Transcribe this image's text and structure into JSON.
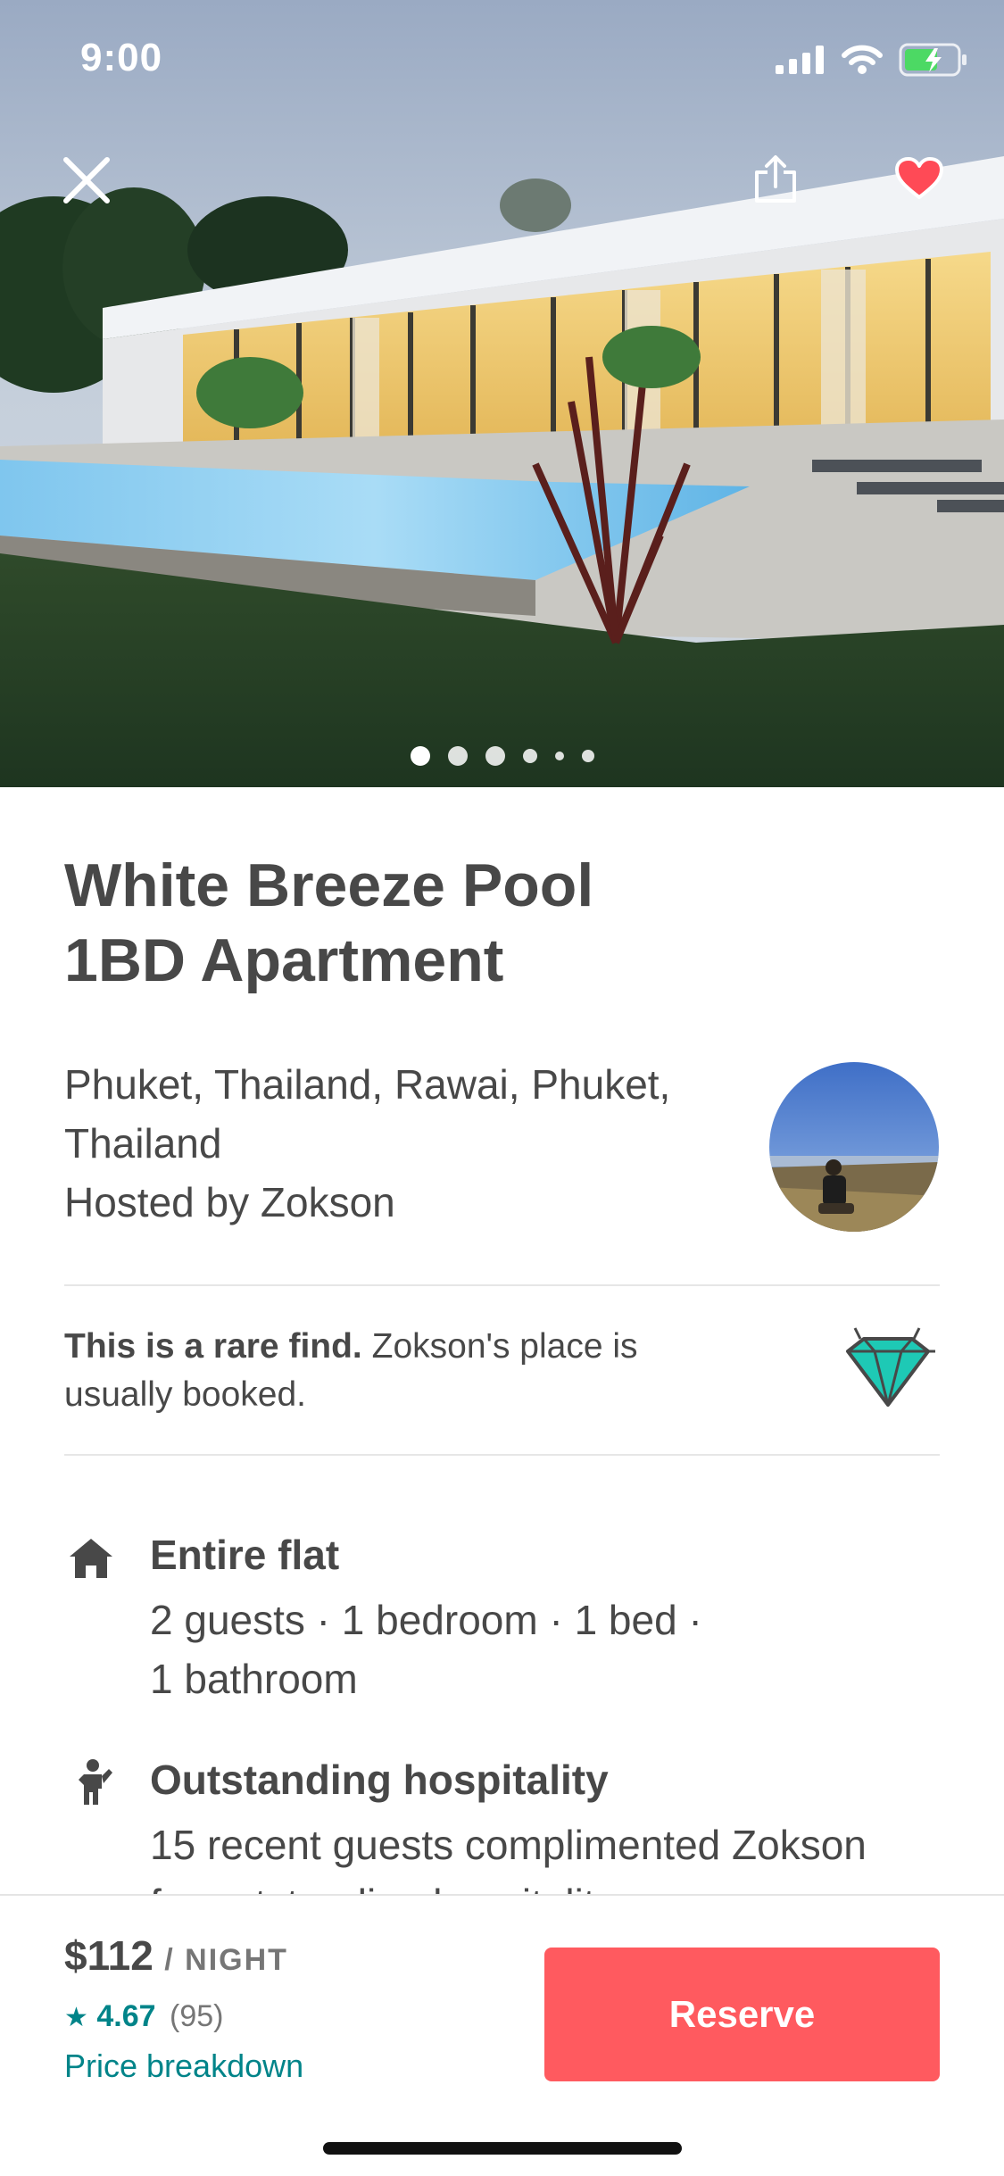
{
  "status_bar": {
    "time": "9:00"
  },
  "hero": {
    "photo_description_icon": "house-with-pool-photo",
    "carousel": {
      "total": 6,
      "active_index": 1
    },
    "actions": {
      "close_icon": "close-icon",
      "share_icon": "share-icon",
      "favorite_icon": "heart-icon"
    },
    "favorite_color": "#ff4a56"
  },
  "listing": {
    "title_line1": "White Breeze Pool",
    "title_line2": "1BD Apartment",
    "location_line1": "Phuket, Thailand, Rawai, Phuket,",
    "location_line2": "Thailand",
    "hosted_by": "Hosted by Zokson",
    "rare_find_bold": "This is a rare find.",
    "rare_find_text": " Zokson's place is usually booked.",
    "features": [
      {
        "icon": "house-icon",
        "title": "Entire flat",
        "description_line1": "2 guests · 1 bedroom · 1 bed ·",
        "description_line2": "1 bathroom"
      },
      {
        "icon": "hospitality-icon",
        "title": "Outstanding hospitality",
        "description_line1": "15 recent guests complimented Zokson",
        "description_line2": "for outstanding hospitality"
      }
    ]
  },
  "booking": {
    "price": "$112",
    "per": "/ NIGHT",
    "star": "★",
    "rating": "4.67",
    "reviews": "(95)",
    "price_breakdown": "Price breakdown",
    "reserve_label": "Reserve",
    "accent_color": "#ff5a5f",
    "link_color": "#008489"
  }
}
